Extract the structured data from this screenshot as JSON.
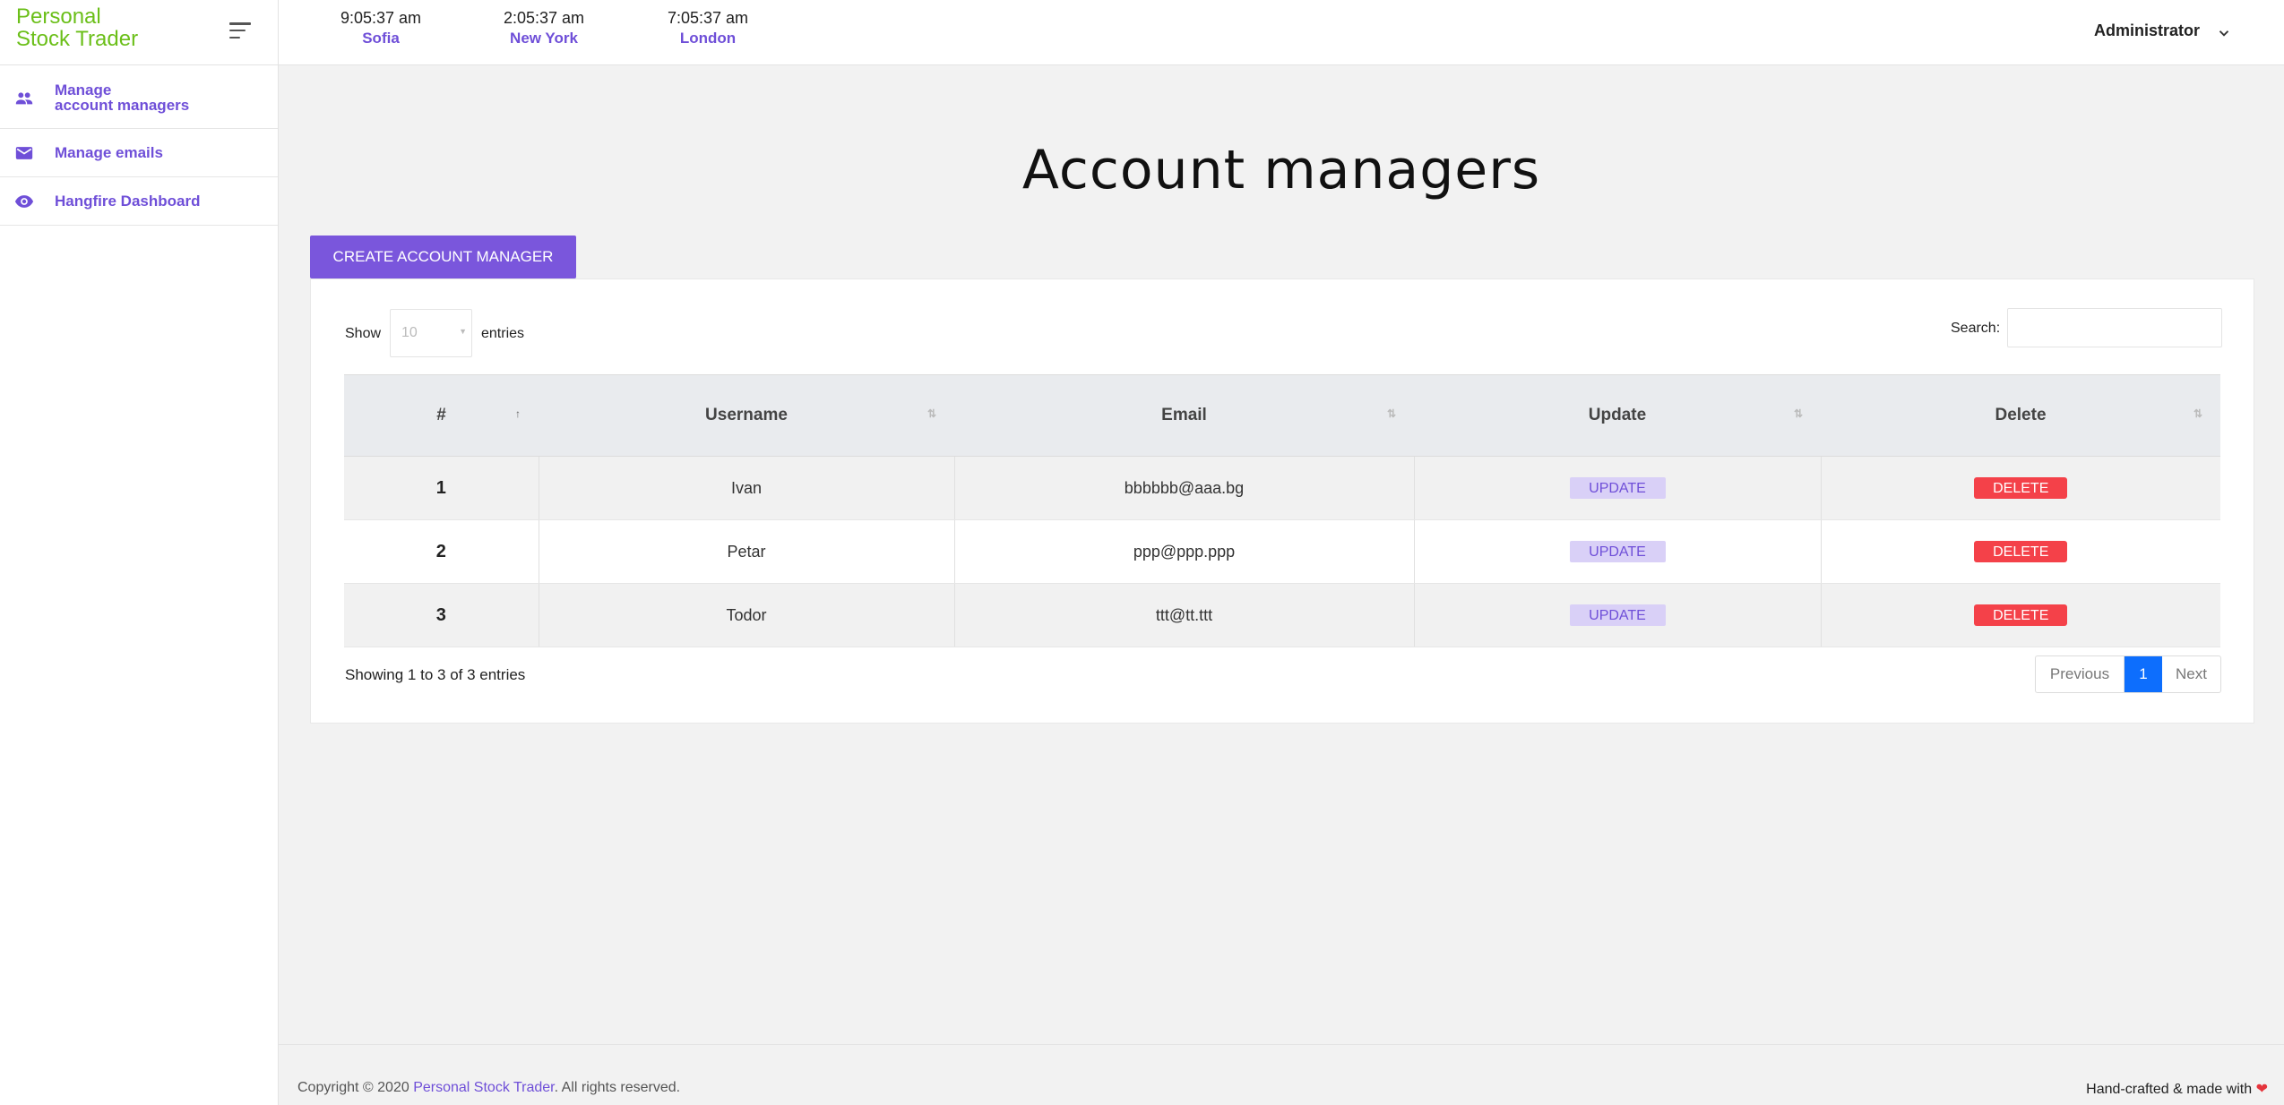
{
  "brand": {
    "line1": "Personal",
    "line2": "Stock Trader"
  },
  "sidebar": {
    "items": [
      {
        "line1": "Manage",
        "line2": "account managers",
        "icon": "people-icon"
      },
      {
        "label": "Manage emails",
        "icon": "mail-icon"
      },
      {
        "label": "Hangfire Dashboard",
        "icon": "eye-icon"
      }
    ]
  },
  "topbar": {
    "clocks": [
      {
        "time": "9:05:37 am",
        "city": "Sofia"
      },
      {
        "time": "2:05:37 am",
        "city": "New York"
      },
      {
        "time": "7:05:37 am",
        "city": "London"
      }
    ],
    "user": "Administrator"
  },
  "main": {
    "title": "Account managers",
    "create_button": "CREATE ACCOUNT MANAGER",
    "length": {
      "show": "Show",
      "value": "10",
      "entries": "entries"
    },
    "search_label": "Search:",
    "search_value": "",
    "columns": [
      "#",
      "Username",
      "Email",
      "Update",
      "Delete"
    ],
    "rows": [
      {
        "num": "1",
        "username": "Ivan",
        "email": "bbbbbb@aaa.bg",
        "update": "UPDATE",
        "delete": "DELETE"
      },
      {
        "num": "2",
        "username": "Petar",
        "email": "ppp@ppp.ppp",
        "update": "UPDATE",
        "delete": "DELETE"
      },
      {
        "num": "3",
        "username": "Todor",
        "email": "ttt@tt.ttt",
        "update": "UPDATE",
        "delete": "DELETE"
      }
    ],
    "info": "Showing 1 to 3 of 3 entries",
    "pagination": {
      "previous": "Previous",
      "current": "1",
      "next": "Next"
    }
  },
  "footer": {
    "copyright_prefix": "Copyright © 2020 ",
    "copyright_link": "Personal Stock Trader",
    "copyright_suffix": ". All rights reserved.",
    "made_with": "Hand-crafted & made with",
    "heart": "❤"
  },
  "colors": {
    "brand_green": "#6bbf19",
    "accent_purple": "#6f4fd8",
    "create_button": "#7a56dc",
    "delete_red": "#f44149",
    "pager_active": "#0d6efd"
  }
}
